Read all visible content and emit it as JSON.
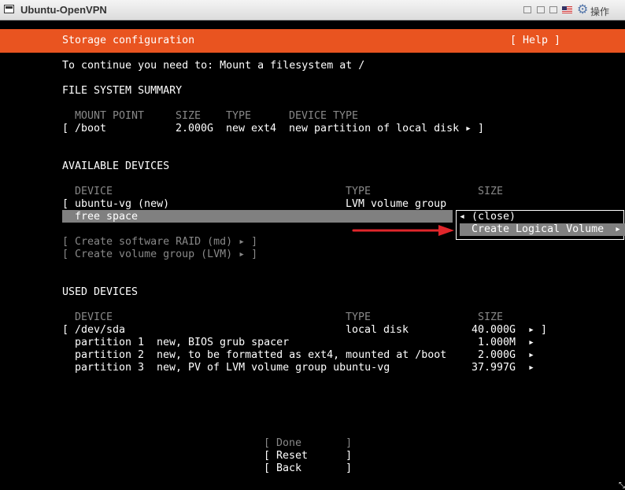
{
  "window": {
    "title": "Ubuntu-OpenVPN",
    "ops_label": "操作",
    "settings_icon": "gear-icon"
  },
  "header": {
    "title": "Storage configuration",
    "help": "[ Help ]"
  },
  "instruction": "To continue you need to: Mount a filesystem at /",
  "fs_summary": {
    "heading": "FILE SYSTEM SUMMARY",
    "columns": [
      "MOUNT POINT",
      "SIZE",
      "TYPE",
      "DEVICE TYPE"
    ],
    "rows": [
      {
        "bracket": "[",
        "mount": "/boot",
        "size": "2.000G",
        "type": "new ext4",
        "device_type": "new partition of local disk",
        "arrow": "▸ ]"
      }
    ]
  },
  "available": {
    "heading": "AVAILABLE DEVICES",
    "columns": [
      "DEVICE",
      "TYPE",
      "SIZE"
    ],
    "vg": {
      "bracket": "[",
      "name": "ubuntu-vg (new)",
      "type": "LVM volume group"
    },
    "free_space": "free space",
    "actions": [
      "[ Create software RAID (md) ▸ ]",
      "[ Create volume group (LVM) ▸ ]"
    ]
  },
  "context_menu": {
    "close_marker": "◂",
    "close": "(close)",
    "create_lv": "Create Logical Volume",
    "create_lv_arrow": "▸"
  },
  "used": {
    "heading": "USED DEVICES",
    "columns": [
      "DEVICE",
      "TYPE",
      "SIZE"
    ],
    "disk": {
      "bracket": "[",
      "name": "/dev/sda",
      "type": "local disk",
      "size": "40.000G",
      "arrow": "▸ ]"
    },
    "partitions": [
      {
        "name": "partition 1",
        "desc": "new, BIOS grub spacer",
        "size": "1.000M",
        "arrow": "▸"
      },
      {
        "name": "partition 2",
        "desc": "new, to be formatted as ext4, mounted at /boot",
        "size": "2.000G",
        "arrow": "▸"
      },
      {
        "name": "partition 3",
        "desc": "new, PV of LVM volume group ubuntu-vg",
        "size": "37.997G",
        "arrow": "▸"
      }
    ]
  },
  "buttons": {
    "done": "[ Done       ]",
    "reset": "[ Reset      ]",
    "back": "[ Back       ]"
  },
  "colors": {
    "header": "#e95420",
    "highlight": "#808080",
    "annotation_arrow": "#e0262b"
  }
}
